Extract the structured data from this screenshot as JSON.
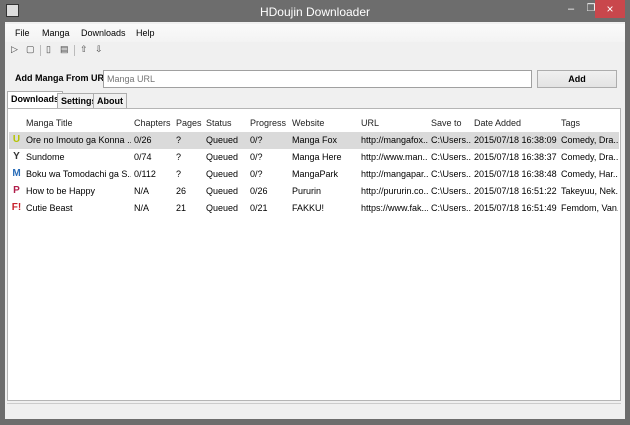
{
  "window": {
    "title": "HDoujin Downloader",
    "minimize": "–",
    "maximize": "❐",
    "close": "×"
  },
  "menu": [
    "File",
    "Manga",
    "Downloads",
    "Help"
  ],
  "toolbar": [
    {
      "icon": "play-icon",
      "glyph": "▷"
    },
    {
      "icon": "stop-icon",
      "glyph": "▢"
    },
    {
      "icon": "clipboard-icon",
      "glyph": "▯"
    },
    {
      "icon": "paste-icon",
      "glyph": "▤"
    },
    {
      "icon": "move-up-icon",
      "glyph": "⇧"
    },
    {
      "icon": "move-down-icon",
      "glyph": "⇩"
    }
  ],
  "url_row": {
    "label": "Add Manga From URL:",
    "placeholder": "Manga URL",
    "add_label": "Add"
  },
  "tabs": [
    "Downloads",
    "Settings",
    "About"
  ],
  "columns": [
    "Manga Title",
    "Chapters",
    "Pages",
    "Status",
    "Progress",
    "Website",
    "URL",
    "Save to",
    "Date Added",
    "Tags"
  ],
  "rows": [
    {
      "icon": "mangafox-icon",
      "glyph": "U",
      "color": "#b5c400",
      "cells": [
        "Ore no Imouto ga Konna ...",
        "0/26",
        "?",
        "Queued",
        "0/?",
        "Manga Fox",
        "http://mangafox...",
        "C:\\Users...",
        "2015/07/18 16:38:09",
        "Comedy, Dra..."
      ]
    },
    {
      "icon": "mangahere-icon",
      "glyph": "Y",
      "color": "#333333",
      "cells": [
        "Sundome",
        "0/74",
        "?",
        "Queued",
        "0/?",
        "Manga Here",
        "http://www.man...",
        "C:\\Users...",
        "2015/07/18 16:38:37",
        "Comedy, Dra..."
      ]
    },
    {
      "icon": "mangapark-icon",
      "glyph": "M",
      "color": "#2a6db8",
      "cells": [
        "Boku wa Tomodachi ga S...",
        "0/112",
        "?",
        "Queued",
        "0/?",
        "MangaPark",
        "http://mangapar...",
        "C:\\Users...",
        "2015/07/18 16:38:48",
        "Comedy, Har..."
      ]
    },
    {
      "icon": "pururin-icon",
      "glyph": "P",
      "color": "#b01d4a",
      "cells": [
        "How to be Happy",
        "N/A",
        "26",
        "Queued",
        "0/26",
        "Pururin",
        "http://pururin.co...",
        "C:\\Users...",
        "2015/07/18 16:51:22",
        "Takeyuu, Nek..."
      ]
    },
    {
      "icon": "fakku-icon",
      "glyph": "F!",
      "color": "#c8202a",
      "cells": [
        "Cutie Beast",
        "N/A",
        "21",
        "Queued",
        "0/21",
        "FAKKU!",
        "https://www.fak...",
        "C:\\Users...",
        "2015/07/18 16:51:49",
        "Femdom, Van..."
      ]
    }
  ],
  "selected_row": 0
}
